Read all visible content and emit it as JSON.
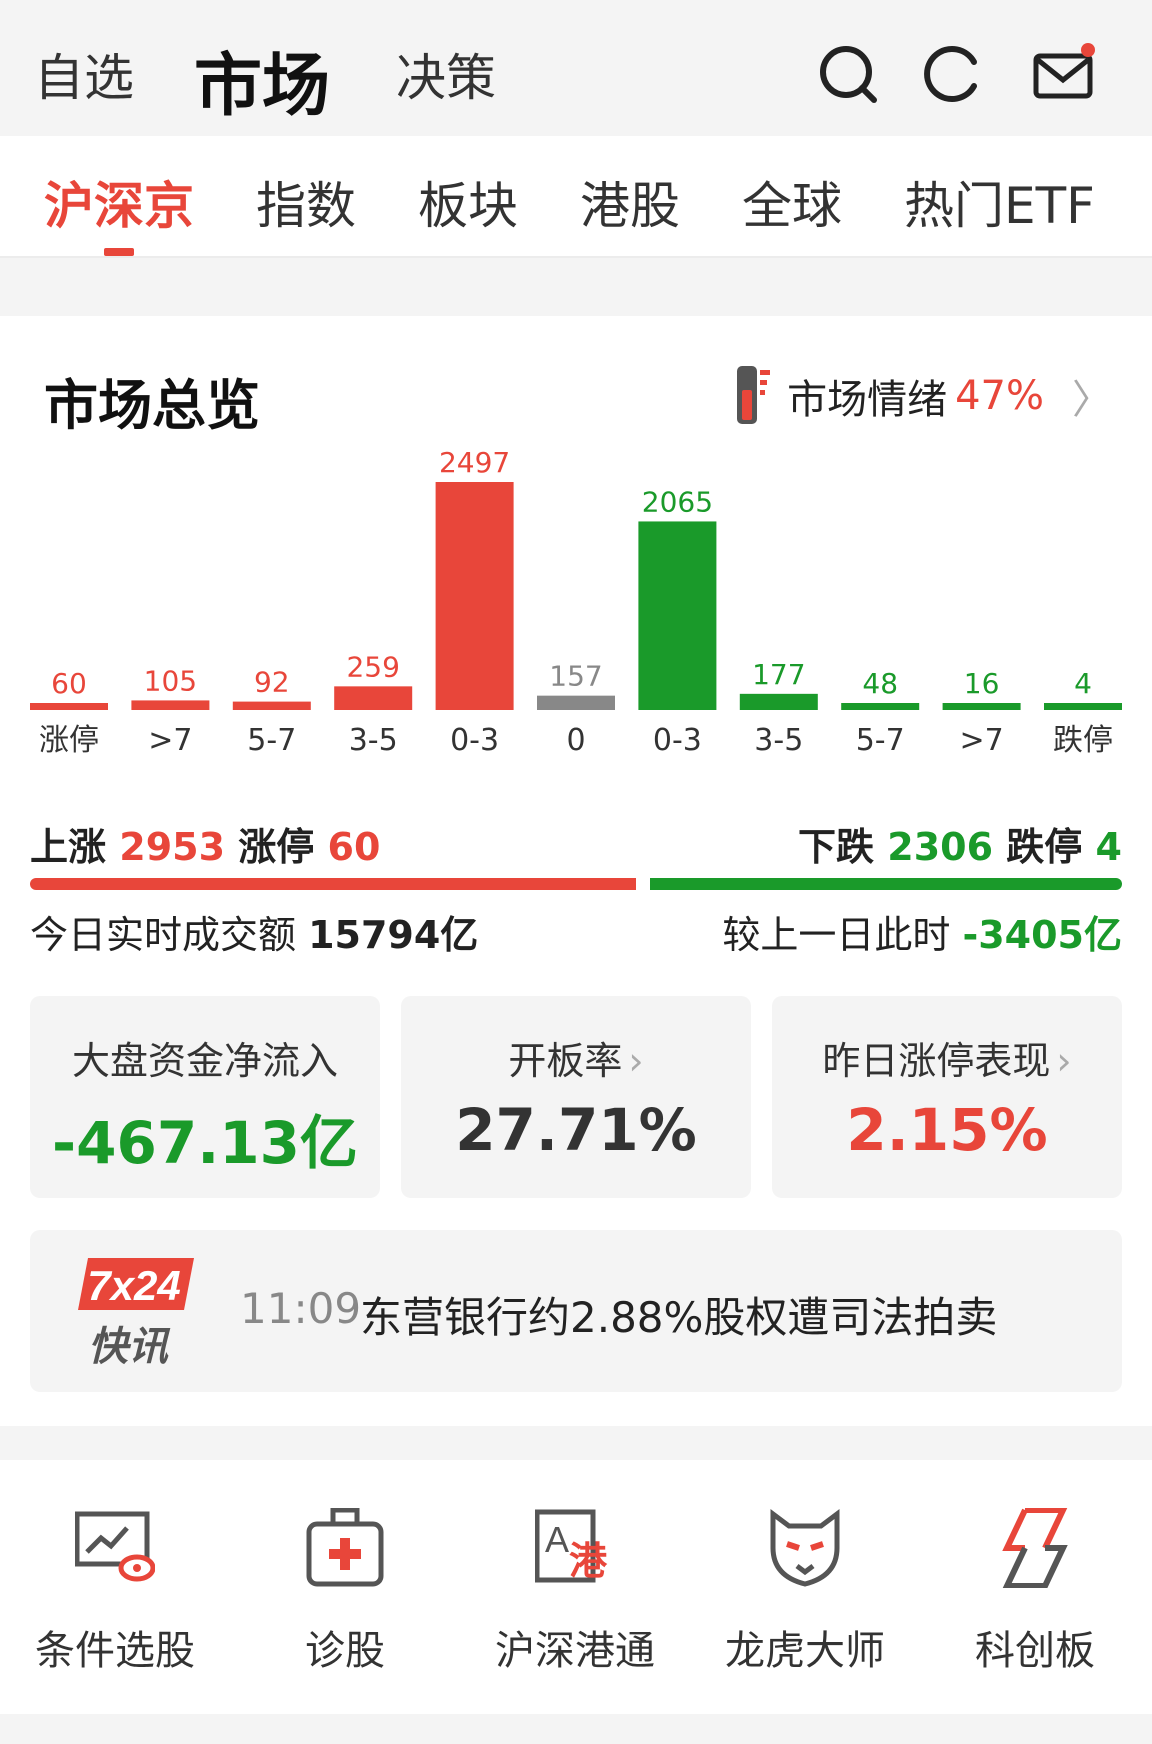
{
  "topnav": {
    "tabs": [
      "自选",
      "市场",
      "决策"
    ],
    "active": 1,
    "icons": [
      "search-icon",
      "refresh-icon",
      "mail-icon"
    ]
  },
  "subtabs": {
    "items": [
      "沪深京",
      "指数",
      "板块",
      "港股",
      "全球",
      "热门ETF"
    ],
    "active": 0
  },
  "overview": {
    "title": "市场总览",
    "mood_label": "市场情绪",
    "mood_value": "47%"
  },
  "chart_data": {
    "type": "bar",
    "categories": [
      "涨停",
      ">7",
      "5-7",
      "3-5",
      "0-3",
      "0",
      "0-3",
      "3-5",
      "5-7",
      ">7",
      "跌停"
    ],
    "values": [
      60,
      105,
      92,
      259,
      2497,
      157,
      2065,
      177,
      48,
      16,
      4
    ],
    "value_labels": [
      "60",
      "105",
      "92",
      "259",
      "2497",
      "157",
      "2065",
      "177",
      "48",
      "16",
      "4"
    ],
    "colors": [
      "#e8463a",
      "#e8463a",
      "#e8463a",
      "#e8463a",
      "#e8463a",
      "#888888",
      "#1a9a2a",
      "#1a9a2a",
      "#1a9a2a",
      "#1a9a2a",
      "#1a9a2a"
    ]
  },
  "summary": {
    "up_label": "上涨",
    "up_value": "2953",
    "limit_up_label": "涨停",
    "limit_up_value": "60",
    "down_label": "下跌",
    "down_value": "2306",
    "limit_down_label": "跌停",
    "limit_down_value": "4",
    "up_ratio": 0.5615,
    "turnover_label": "今日实时成交额",
    "turnover_value": "15794亿",
    "compare_label": "较上一日此时",
    "compare_value": "-3405亿"
  },
  "stats": [
    {
      "label": "大盘资金净流入",
      "value": "-467.13亿",
      "color": "#1a9a2a",
      "chevron": ""
    },
    {
      "label": "开板率",
      "value": "27.71%",
      "color": "#333333",
      "chevron": "›"
    },
    {
      "label": "昨日涨停表现",
      "value": "2.15%",
      "color": "#e8463a",
      "chevron": "›"
    }
  ],
  "news": {
    "badge_top": "7x24",
    "badge_bottom": "快讯",
    "time": "11:09",
    "text": "东营银行约2.88%股权遭司法拍卖"
  },
  "tools": [
    {
      "label": "条件选股",
      "icon": "stock-screener-icon"
    },
    {
      "label": "诊股",
      "icon": "medical-kit-icon"
    },
    {
      "label": "沪深港通",
      "icon": "hk-connect-icon"
    },
    {
      "label": "龙虎大师",
      "icon": "leopard-icon"
    },
    {
      "label": "科创板",
      "icon": "star-market-icon"
    }
  ]
}
